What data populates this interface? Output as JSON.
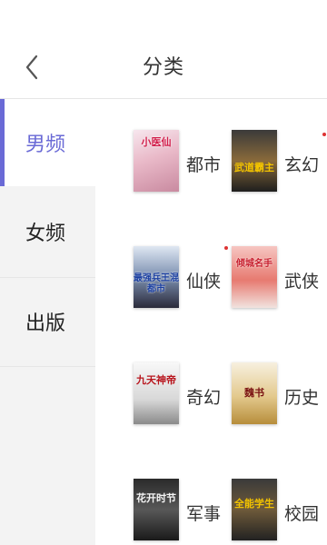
{
  "header": {
    "title": "分类"
  },
  "sidebar": {
    "items": [
      {
        "label": "男频",
        "active": true
      },
      {
        "label": "女频",
        "active": false
      },
      {
        "label": "出版",
        "active": false
      }
    ]
  },
  "categories": [
    {
      "label": "都市",
      "cover_text": "小医仙"
    },
    {
      "label": "玄幻",
      "cover_text": "武道霸主"
    },
    {
      "label": "仙侠",
      "cover_text": "最强兵王混都市"
    },
    {
      "label": "武侠",
      "cover_text": "倾城名手"
    },
    {
      "label": "奇幻",
      "cover_text": "九天神帝"
    },
    {
      "label": "历史",
      "cover_text": "魏书"
    },
    {
      "label": "军事",
      "cover_text": "花开时节"
    },
    {
      "label": "校园",
      "cover_text": "全能学生"
    }
  ],
  "colors": {
    "accent": "#6a6ad6",
    "dot": "#dd3333"
  }
}
